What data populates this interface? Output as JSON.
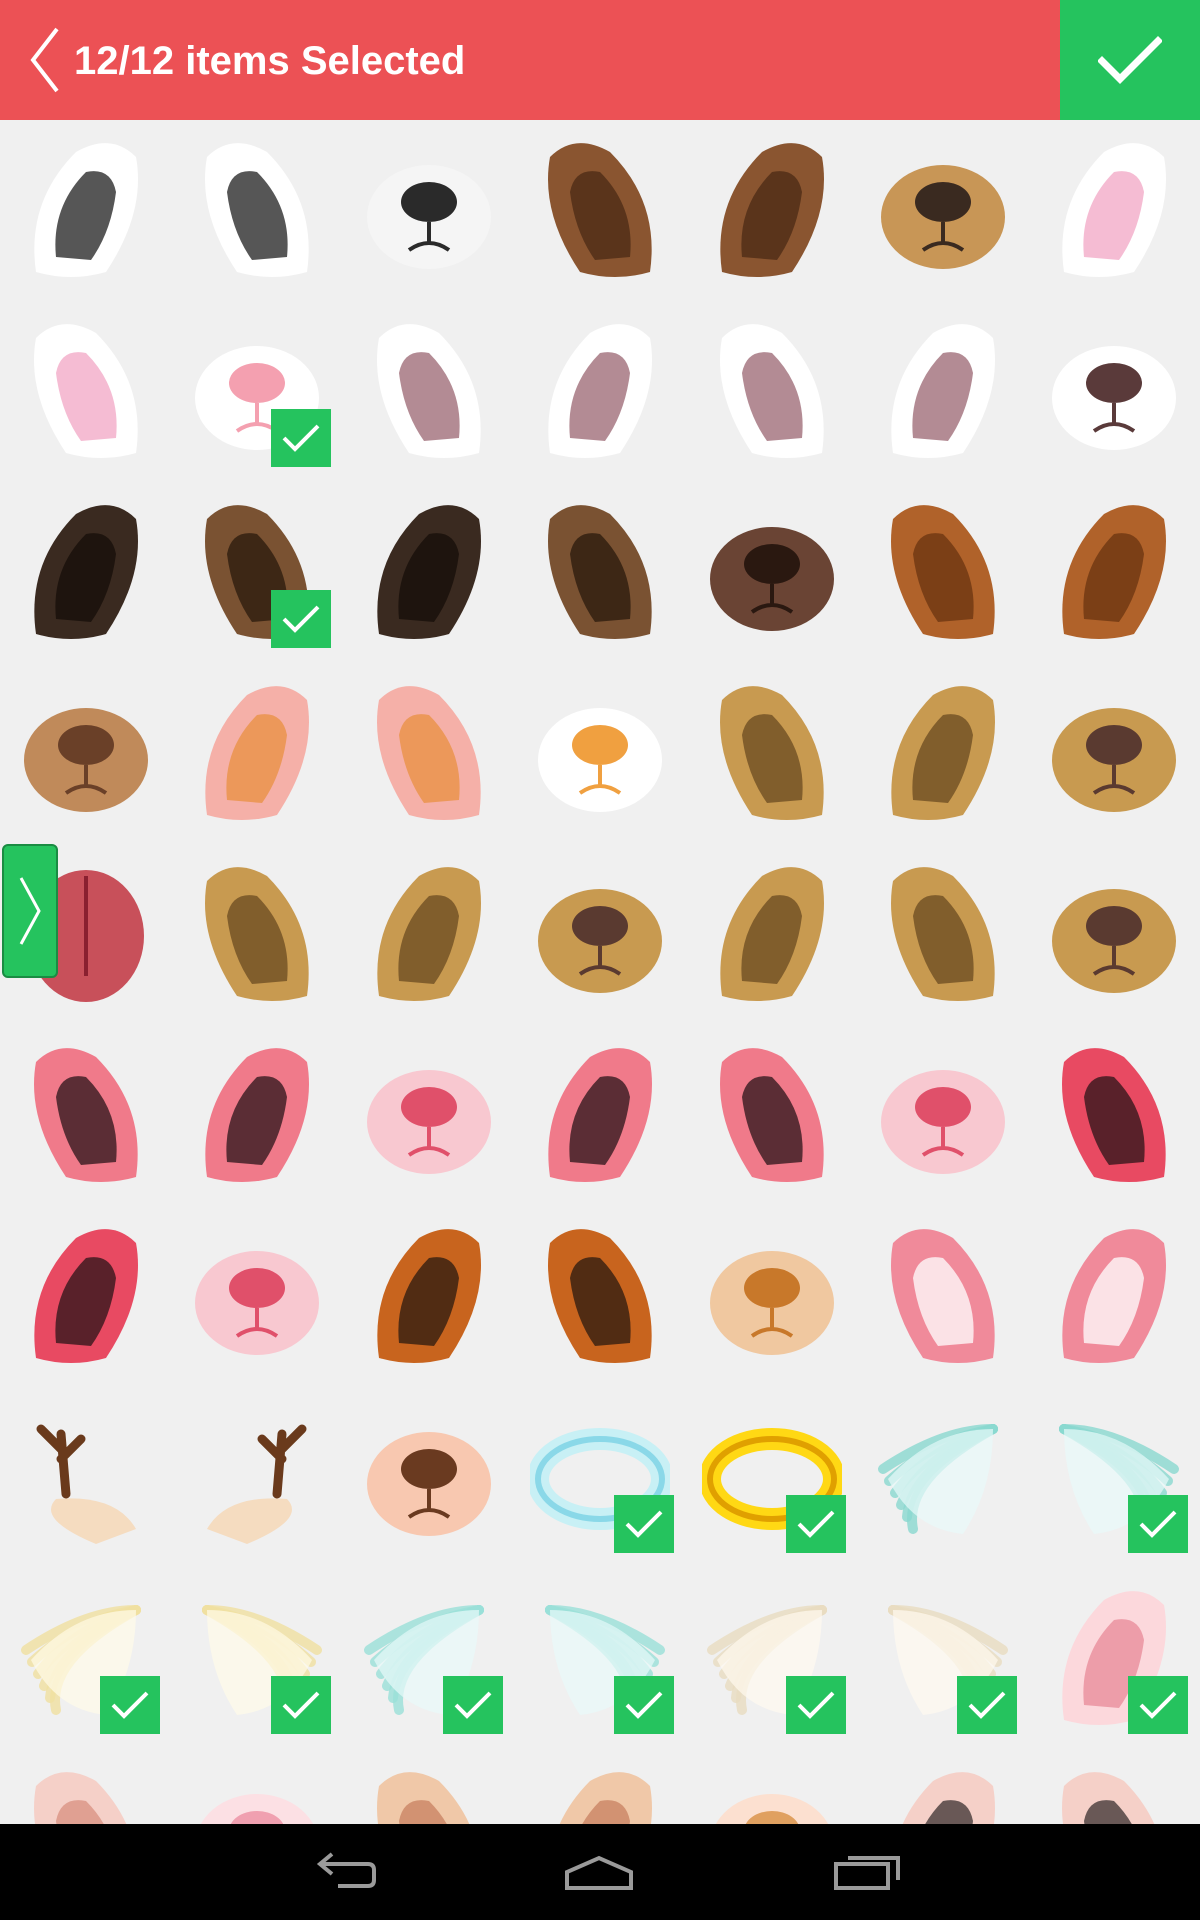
{
  "header": {
    "title": "12/12 items Selected",
    "accent_color": "#ec5155",
    "confirm_color": "#25c35e",
    "back_icon": "chevron-left-icon",
    "confirm_icon": "check-icon"
  },
  "grid": {
    "items": [
      {
        "kind": "ear",
        "variant": "dalmatian-ear-left",
        "colors": [
          "#ffffff",
          "#1e1e1e"
        ],
        "selected": false
      },
      {
        "kind": "ear",
        "variant": "dalmatian-ear-right",
        "colors": [
          "#ffffff",
          "#1e1e1e"
        ],
        "selected": false
      },
      {
        "kind": "nose",
        "variant": "dalmatian-nose",
        "colors": [
          "#f5f5f5",
          "#2a2a2a"
        ],
        "selected": false
      },
      {
        "kind": "ear",
        "variant": "brown-dog-ear-left",
        "colors": [
          "#8a5530",
          "#4a2a14"
        ],
        "selected": false
      },
      {
        "kind": "ear",
        "variant": "brown-dog-ear-right",
        "colors": [
          "#8a5530",
          "#4a2a14"
        ],
        "selected": false
      },
      {
        "kind": "nose",
        "variant": "brown-dog-nose",
        "colors": [
          "#c89656",
          "#3a2a20"
        ],
        "selected": false
      },
      {
        "kind": "ear",
        "variant": "bunny-ear-bow",
        "colors": [
          "#ffffff",
          "#f2a6c4"
        ],
        "selected": false
      },
      {
        "kind": "ear",
        "variant": "bunny-ear-bow-left",
        "colors": [
          "#ffffff",
          "#f2a6c4"
        ],
        "selected": false
      },
      {
        "kind": "nose",
        "variant": "bunny-nose",
        "colors": [
          "#ffffff",
          "#f4a0b0"
        ],
        "selected": true
      },
      {
        "kind": "ear",
        "variant": "cat-ear-white-left",
        "colors": [
          "#ffffff",
          "#9a6470"
        ],
        "selected": false
      },
      {
        "kind": "ear",
        "variant": "cat-ear-white-right",
        "colors": [
          "#ffffff",
          "#9a6470"
        ],
        "selected": false
      },
      {
        "kind": "ear",
        "variant": "cat-ear-white-left-2",
        "colors": [
          "#ffffff",
          "#9a6470"
        ],
        "selected": false
      },
      {
        "kind": "ear",
        "variant": "cat-ear-white-right-2",
        "colors": [
          "#ffffff",
          "#9a6470"
        ],
        "selected": false
      },
      {
        "kind": "nose",
        "variant": "white-dog-nose",
        "colors": [
          "#ffffff",
          "#5a3a3a"
        ],
        "selected": false
      },
      {
        "kind": "ear",
        "variant": "dark-dog-ear-left",
        "colors": [
          "#3a2a20",
          "#160e08"
        ],
        "selected": false
      },
      {
        "kind": "ear",
        "variant": "brown-floppy-ear-left",
        "colors": [
          "#7a5232",
          "#2a1a0c"
        ],
        "selected": true
      },
      {
        "kind": "ear",
        "variant": "dark-dog-ear-right",
        "colors": [
          "#3a2a20",
          "#160e08"
        ],
        "selected": false
      },
      {
        "kind": "ear",
        "variant": "brown-floppy-ear-right",
        "colors": [
          "#7a5232",
          "#2a1a0c"
        ],
        "selected": false
      },
      {
        "kind": "nose",
        "variant": "dark-brown-nose",
        "colors": [
          "#6a4434",
          "#2a1810"
        ],
        "selected": false
      },
      {
        "kind": "ear",
        "variant": "curly-ear-left",
        "colors": [
          "#b0622a",
          "#6a3410"
        ],
        "selected": false
      },
      {
        "kind": "ear",
        "variant": "curly-ear-right",
        "colors": [
          "#b0622a",
          "#6a3410"
        ],
        "selected": false
      },
      {
        "kind": "nose",
        "variant": "tan-dog-nose",
        "colors": [
          "#c08a5a",
          "#6a4028"
        ],
        "selected": false
      },
      {
        "kind": "ear",
        "variant": "fox-ear-left",
        "colors": [
          "#f5b0a8",
          "#e89040"
        ],
        "selected": false
      },
      {
        "kind": "ear",
        "variant": "fox-ear-right",
        "colors": [
          "#f5b0a8",
          "#e89040"
        ],
        "selected": false
      },
      {
        "kind": "nose",
        "variant": "cat-nose-orange",
        "colors": [
          "#ffffff",
          "#f0a040"
        ],
        "selected": false
      },
      {
        "kind": "ear",
        "variant": "spotted-ear-left",
        "colors": [
          "#c89a50",
          "#6a4a20"
        ],
        "selected": false
      },
      {
        "kind": "ear",
        "variant": "spotted-ear-right",
        "colors": [
          "#c89a50",
          "#6a4a20"
        ],
        "selected": false
      },
      {
        "kind": "nose",
        "variant": "spotted-nose",
        "colors": [
          "#c89a50",
          "#5a3a30"
        ],
        "selected": false
      },
      {
        "kind": "tongue",
        "variant": "tongue",
        "colors": [
          "#c8505a",
          "#8a2030"
        ],
        "selected": false
      },
      {
        "kind": "ear",
        "variant": "spotted-ear-left-2",
        "colors": [
          "#c89a50",
          "#6a4a20"
        ],
        "selected": false
      },
      {
        "kind": "ear",
        "variant": "spotted-ear-right-2",
        "colors": [
          "#c89a50",
          "#6a4a20"
        ],
        "selected": false
      },
      {
        "kind": "nose",
        "variant": "spotted-nose-2",
        "colors": [
          "#c89a50",
          "#5a3a30"
        ],
        "selected": false
      },
      {
        "kind": "ear",
        "variant": "spotted-ear-left-3",
        "colors": [
          "#c89a50",
          "#6a4a20"
        ],
        "selected": false
      },
      {
        "kind": "ear",
        "variant": "spotted-ear-right-3",
        "colors": [
          "#c89a50",
          "#6a4a20"
        ],
        "selected": false
      },
      {
        "kind": "nose",
        "variant": "spotted-nose-3",
        "colors": [
          "#c89a50",
          "#5a3a30"
        ],
        "selected": false
      },
      {
        "kind": "ear",
        "variant": "pink-ear-left",
        "colors": [
          "#f07a8a",
          "#2a1418"
        ],
        "selected": false
      },
      {
        "kind": "ear",
        "variant": "pink-ear-right",
        "colors": [
          "#f07a8a",
          "#2a1418"
        ],
        "selected": false
      },
      {
        "kind": "nose",
        "variant": "mouse-nose",
        "colors": [
          "#f8c8d0",
          "#e0506a"
        ],
        "selected": false
      },
      {
        "kind": "ear",
        "variant": "pink-ear-left-2",
        "colors": [
          "#f07a8a",
          "#2a1418"
        ],
        "selected": false
      },
      {
        "kind": "ear",
        "variant": "pink-ear-right-2",
        "colors": [
          "#f07a8a",
          "#2a1418"
        ],
        "selected": false
      },
      {
        "kind": "nose",
        "variant": "mouse-nose-2",
        "colors": [
          "#f8c8d0",
          "#e0506a"
        ],
        "selected": false
      },
      {
        "kind": "ear",
        "variant": "pink-ear-right-3",
        "colors": [
          "#e84a62",
          "#2a1418"
        ],
        "selected": false
      },
      {
        "kind": "ear",
        "variant": "pink-ear-left-3",
        "colors": [
          "#e84a62",
          "#2a1418"
        ],
        "selected": false
      },
      {
        "kind": "nose",
        "variant": "mouse-nose-3",
        "colors": [
          "#f8c8d0",
          "#e0506a"
        ],
        "selected": false
      },
      {
        "kind": "ear",
        "variant": "calico-ear-left",
        "colors": [
          "#c8641e",
          "#2a1a10"
        ],
        "selected": false
      },
      {
        "kind": "ear",
        "variant": "calico-ear-right",
        "colors": [
          "#c8641e",
          "#2a1a10"
        ],
        "selected": false
      },
      {
        "kind": "nose",
        "variant": "fox-nose",
        "colors": [
          "#f0c8a0",
          "#c8782a"
        ],
        "selected": false
      },
      {
        "kind": "ear",
        "variant": "light-pink-ear-left",
        "colors": [
          "#f08a9a",
          "#ffffff"
        ],
        "selected": false
      },
      {
        "kind": "ear",
        "variant": "light-pink-ear-right",
        "colors": [
          "#f08a9a",
          "#ffffff"
        ],
        "selected": false
      },
      {
        "kind": "antler",
        "variant": "deer-antlers-ears-left",
        "colors": [
          "#6a3a1c",
          "#f5dcc0"
        ],
        "selected": false
      },
      {
        "kind": "antler",
        "variant": "deer-antlers-ears-right",
        "colors": [
          "#6a3a1c",
          "#f5dcc0"
        ],
        "selected": false
      },
      {
        "kind": "nose",
        "variant": "deer-nose",
        "colors": [
          "#f8c8b0",
          "#6a3a20"
        ],
        "selected": false
      },
      {
        "kind": "halo",
        "variant": "blue-halo",
        "colors": [
          "#c8f0f5",
          "#8ad8e8"
        ],
        "selected": true
      },
      {
        "kind": "halo",
        "variant": "gold-halo",
        "colors": [
          "#ffd814",
          "#e0a000"
        ],
        "selected": true
      },
      {
        "kind": "wing",
        "variant": "mint-wing-left",
        "colors": [
          "#e8fafa",
          "#8ad8d0"
        ],
        "selected": false
      },
      {
        "kind": "wing",
        "variant": "mint-wing-right",
        "colors": [
          "#e8fafa",
          "#8ad8d0"
        ],
        "selected": true
      },
      {
        "kind": "wing",
        "variant": "cream-wing-left",
        "colors": [
          "#fffbe8",
          "#f0e0a0"
        ],
        "selected": true
      },
      {
        "kind": "wing",
        "variant": "cream-wing-right",
        "colors": [
          "#fffbe8",
          "#f0e0a0"
        ],
        "selected": true
      },
      {
        "kind": "wing",
        "variant": "aqua-wing-left",
        "colors": [
          "#e8fafa",
          "#9ae0d8"
        ],
        "selected": true
      },
      {
        "kind": "wing",
        "variant": "aqua-wing-right",
        "colors": [
          "#e8fafa",
          "#9ae0d8"
        ],
        "selected": true
      },
      {
        "kind": "wing",
        "variant": "ivory-wing-left",
        "colors": [
          "#fffaf0",
          "#e8dcc0"
        ],
        "selected": true
      },
      {
        "kind": "wing",
        "variant": "ivory-wing-right",
        "colors": [
          "#fffaf0",
          "#e8dcc0"
        ],
        "selected": true
      },
      {
        "kind": "ear",
        "variant": "round-pink-ear",
        "colors": [
          "#fcd8dc",
          "#e88a98"
        ],
        "selected": true
      },
      {
        "kind": "ear",
        "variant": "round-ear-partial-1",
        "colors": [
          "#f5d0c8",
          "#d89080"
        ],
        "selected": false
      },
      {
        "kind": "nose",
        "variant": "pink-nose-partial",
        "colors": [
          "#fce0e4",
          "#f0a0b0"
        ],
        "selected": false
      },
      {
        "kind": "ear",
        "variant": "round-ear-partial-2",
        "colors": [
          "#f0c8a8",
          "#c88060"
        ],
        "selected": false
      },
      {
        "kind": "ear",
        "variant": "round-ear-partial-3",
        "colors": [
          "#f0c8a8",
          "#c88060"
        ],
        "selected": false
      },
      {
        "kind": "nose",
        "variant": "fox-nose-partial",
        "colors": [
          "#fce0d0",
          "#e0a060"
        ],
        "selected": false
      },
      {
        "kind": "ear",
        "variant": "dark-ear-partial-1",
        "colors": [
          "#f5d0c8",
          "#3a3030"
        ],
        "selected": false
      },
      {
        "kind": "ear",
        "variant": "dark-ear-partial-2",
        "colors": [
          "#f5d0c8",
          "#3a3030"
        ],
        "selected": false
      }
    ]
  },
  "side_tab": {
    "icon": "chevron-right-icon",
    "color": "#25c35e"
  },
  "navbar": {
    "back_icon": "nav-back-icon",
    "home_icon": "nav-home-icon",
    "recents_icon": "nav-recents-icon"
  }
}
